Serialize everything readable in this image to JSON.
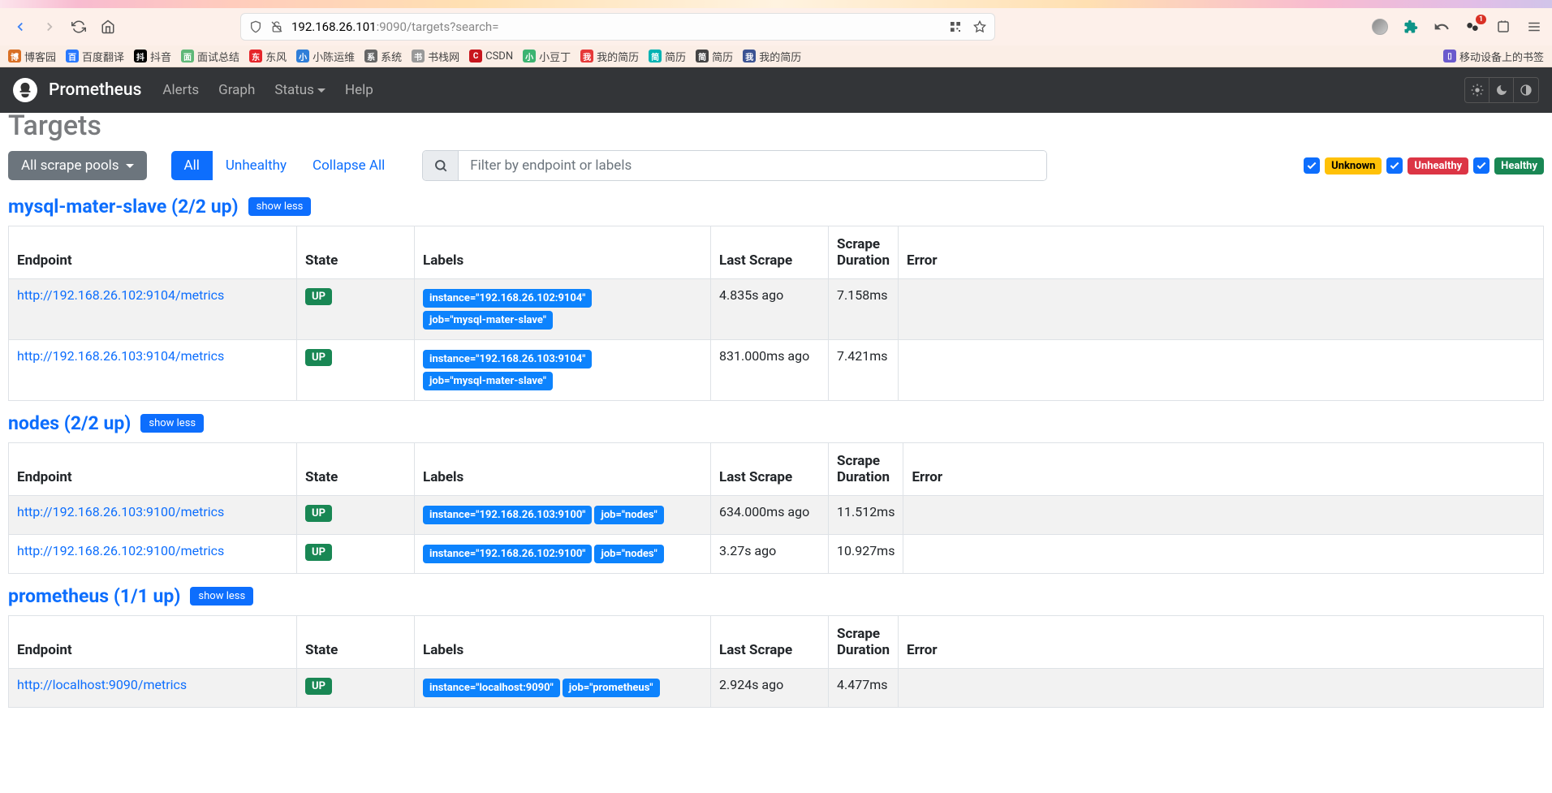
{
  "browser": {
    "url_host": "192.168.26.101",
    "url_path": ":9090/targets?search=",
    "bookmarks": [
      {
        "label": "博客园",
        "color": "#d97025"
      },
      {
        "label": "百度翻译",
        "color": "#2878ff"
      },
      {
        "label": "抖音",
        "color": "#000"
      },
      {
        "label": "面试总结",
        "color": "#5fb878"
      },
      {
        "label": "东风",
        "color": "#e6252a"
      },
      {
        "label": "小陈运维",
        "color": "#2f7ed8"
      },
      {
        "label": "系统",
        "color": "#666"
      },
      {
        "label": "书栈网",
        "color": "#999"
      },
      {
        "label": "CSDN",
        "color": "#c8161d"
      },
      {
        "label": "小豆丁",
        "color": "#3cb371"
      },
      {
        "label": "我的简历",
        "color": "#e63939"
      },
      {
        "label": "简历",
        "color": "#00b3b3"
      },
      {
        "label": "简历",
        "color": "#444"
      },
      {
        "label": "我的简历",
        "color": "#3b5393"
      }
    ],
    "right_bookmark": "移动设备上的书签",
    "notif_badge": "1"
  },
  "prom_nav": {
    "brand": "Prometheus",
    "items": [
      "Alerts",
      "Graph",
      "Status",
      "Help"
    ]
  },
  "page": {
    "title": "Targets",
    "all_pools": "All scrape pools",
    "btn_all": "All",
    "btn_unhealthy": "Unhealthy",
    "btn_collapse": "Collapse All",
    "search_placeholder": "Filter by endpoint or labels",
    "filter_unknown": "Unknown",
    "filter_unhealthy": "Unhealthy",
    "filter_healthy": "Healthy",
    "show_less": "show less",
    "headers": {
      "endpoint": "Endpoint",
      "state": "State",
      "labels": "Labels",
      "last": "Last Scrape",
      "duration": "Scrape Duration",
      "error": "Error"
    }
  },
  "pools": [
    {
      "title": "mysql-mater-slave (2/2 up)",
      "rows": [
        {
          "endpoint": "http://192.168.26.102:9104/metrics",
          "state": "UP",
          "labels": [
            "instance=\"192.168.26.102:9104\"",
            "job=\"mysql-mater-slave\""
          ],
          "last": "4.835s ago",
          "dur": "7.158ms",
          "err": ""
        },
        {
          "endpoint": "http://192.168.26.103:9104/metrics",
          "state": "UP",
          "labels": [
            "instance=\"192.168.26.103:9104\"",
            "job=\"mysql-mater-slave\""
          ],
          "last": "831.000ms ago",
          "dur": "7.421ms",
          "err": ""
        }
      ]
    },
    {
      "title": "nodes (2/2 up)",
      "rows": [
        {
          "endpoint": "http://192.168.26.103:9100/metrics",
          "state": "UP",
          "labels": [
            "instance=\"192.168.26.103:9100\"",
            "job=\"nodes\""
          ],
          "last": "634.000ms ago",
          "dur": "11.512ms",
          "err": ""
        },
        {
          "endpoint": "http://192.168.26.102:9100/metrics",
          "state": "UP",
          "labels": [
            "instance=\"192.168.26.102:9100\"",
            "job=\"nodes\""
          ],
          "last": "3.27s ago",
          "dur": "10.927ms",
          "err": ""
        }
      ]
    },
    {
      "title": "prometheus (1/1 up)",
      "rows": [
        {
          "endpoint": "http://localhost:9090/metrics",
          "state": "UP",
          "labels": [
            "instance=\"localhost:9090\"",
            "job=\"prometheus\""
          ],
          "last": "2.924s ago",
          "dur": "4.477ms",
          "err": ""
        }
      ]
    }
  ]
}
